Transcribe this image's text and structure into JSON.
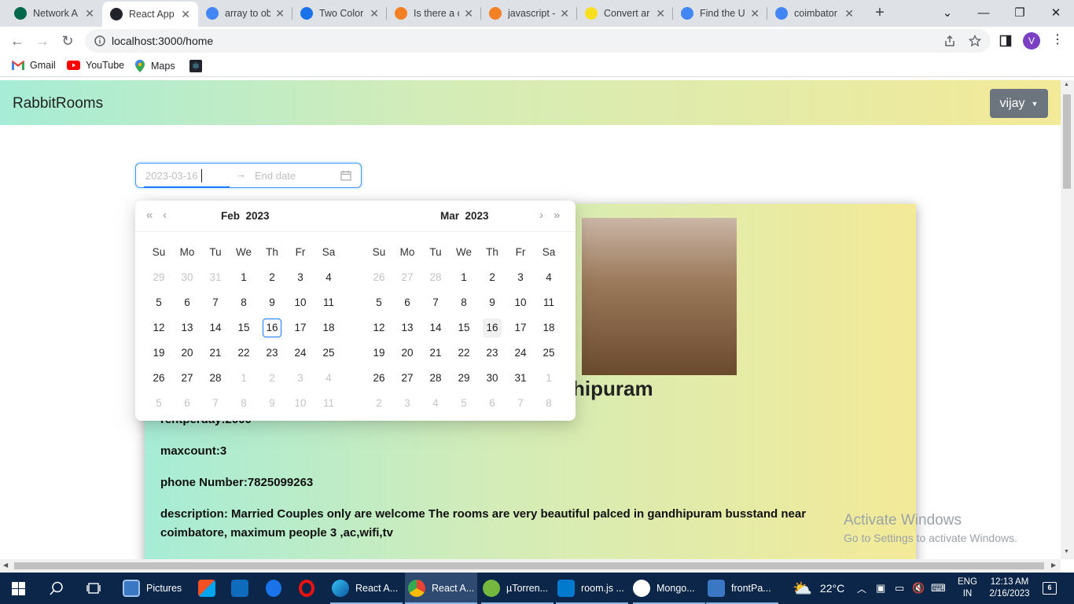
{
  "browser": {
    "tabs": [
      {
        "title": "Network A",
        "icon": "mongodb-icon",
        "color": "#00684a"
      },
      {
        "title": "React App",
        "icon": "react-icon",
        "color": "#20232a"
      },
      {
        "title": "array to ob",
        "icon": "google-icon",
        "color": "#4285f4"
      },
      {
        "title": "Two Color",
        "icon": "codepen-icon",
        "color": "#1a73e8"
      },
      {
        "title": "Is there a c",
        "icon": "stackoverflow-icon",
        "color": "#f48024"
      },
      {
        "title": "javascript -",
        "icon": "stackoverflow-icon",
        "color": "#f48024"
      },
      {
        "title": "Convert ar",
        "icon": "js-icon",
        "color": "#f7df1e"
      },
      {
        "title": "Find the U",
        "icon": "google-icon",
        "color": "#4285f4"
      },
      {
        "title": "coimbator",
        "icon": "google-icon",
        "color": "#4285f4"
      }
    ],
    "url": "localhost:3000/home",
    "profile_initial": "V",
    "bookmarks": [
      {
        "label": "Gmail",
        "icon": "gmail-icon"
      },
      {
        "label": "YouTube",
        "icon": "youtube-icon"
      },
      {
        "label": "Maps",
        "icon": "maps-icon"
      }
    ]
  },
  "app": {
    "brand": "RabbitRooms",
    "user": "vijay",
    "date_start": "2023-03-16",
    "date_end_placeholder": "End date",
    "room_name": "hipuram",
    "rent": "rentperday:2000",
    "maxcount": "maxcount:3",
    "phone": "phone Number:7825099263",
    "description_line1": "description: Married Couples only are welcome The rooms are very beautiful palced in gandhipuram busstand near",
    "description_line2": "coimbatore, maximum people 3 ,ac,wifi,tv"
  },
  "calendar": {
    "weekdays": [
      "Su",
      "Mo",
      "Tu",
      "We",
      "Th",
      "Fr",
      "Sa"
    ],
    "left": {
      "month": "Feb",
      "year": "2023",
      "weeks": [
        [
          "29",
          "30",
          "31",
          "1",
          "2",
          "3",
          "4"
        ],
        [
          "5",
          "6",
          "7",
          "8",
          "9",
          "10",
          "11"
        ],
        [
          "12",
          "13",
          "14",
          "15",
          "16",
          "17",
          "18"
        ],
        [
          "19",
          "20",
          "21",
          "22",
          "23",
          "24",
          "25"
        ],
        [
          "26",
          "27",
          "28",
          "1",
          "2",
          "3",
          "4"
        ],
        [
          "5",
          "6",
          "7",
          "8",
          "9",
          "10",
          "11"
        ]
      ]
    },
    "right": {
      "month": "Mar",
      "year": "2023",
      "weeks": [
        [
          "26",
          "27",
          "28",
          "1",
          "2",
          "3",
          "4"
        ],
        [
          "5",
          "6",
          "7",
          "8",
          "9",
          "10",
          "11"
        ],
        [
          "12",
          "13",
          "14",
          "15",
          "16",
          "17",
          "18"
        ],
        [
          "19",
          "20",
          "21",
          "22",
          "23",
          "24",
          "25"
        ],
        [
          "26",
          "27",
          "28",
          "29",
          "30",
          "31",
          "1"
        ],
        [
          "2",
          "3",
          "4",
          "5",
          "6",
          "7",
          "8"
        ]
      ]
    }
  },
  "watermark": {
    "title": "Activate Windows",
    "subtitle": "Go to Settings to activate Windows."
  },
  "taskbar": {
    "items": [
      {
        "label": "Pictures",
        "color": "#3b78c4"
      },
      {
        "label": "React A...",
        "color": "#0a84d6"
      },
      {
        "label": "React A...",
        "color": "#4285f4"
      },
      {
        "label": "µTorren...",
        "color": "#76b83f"
      },
      {
        "label": "room.js ...",
        "color": "#007acc"
      },
      {
        "label": "Mongo...",
        "color": "#00684a"
      },
      {
        "label": "frontPa...",
        "color": "#3b78c4"
      }
    ],
    "weather": "22°C",
    "lang1": "ENG",
    "lang2": "IN",
    "time": "12:13 AM",
    "date": "2/16/2023",
    "notifications": "6"
  }
}
